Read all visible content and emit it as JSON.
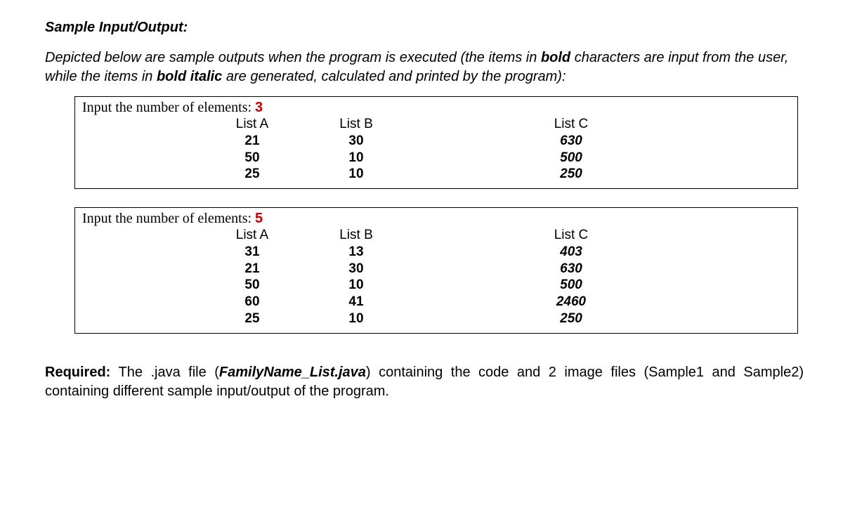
{
  "title": "Sample Input/Output:",
  "intro": {
    "p1a": "Depicted below are sample outputs when the program is executed (the items in ",
    "p1b": "bold",
    "p1c": " characters are input from the user, while the items in ",
    "p1d": "bold italic",
    "p1e": " are generated, calculated and printed by the program):"
  },
  "prompt_label": "Input the number of elements: ",
  "headers": {
    "a": "List A",
    "b": "List B",
    "c": "List C"
  },
  "sample1": {
    "n": "3",
    "rows": [
      {
        "a": "21",
        "b": "30",
        "c": "630"
      },
      {
        "a": "50",
        "b": "10",
        "c": "500"
      },
      {
        "a": "25",
        "b": "10",
        "c": "250"
      }
    ]
  },
  "sample2": {
    "n": "5",
    "rows": [
      {
        "a": "31",
        "b": "13",
        "c": "403"
      },
      {
        "a": "21",
        "b": "30",
        "c": "630"
      },
      {
        "a": "50",
        "b": "10",
        "c": "500"
      },
      {
        "a": "60",
        "b": "41",
        "c": "2460"
      },
      {
        "a": "25",
        "b": "10",
        "c": "250"
      }
    ]
  },
  "required": {
    "label": "Required:",
    "t1": " The .java file (",
    "fname": "FamilyName_List.java",
    "t2": ") containing the code and 2 image files (Sample1 and Sample2) containing different sample input/output of the program."
  }
}
